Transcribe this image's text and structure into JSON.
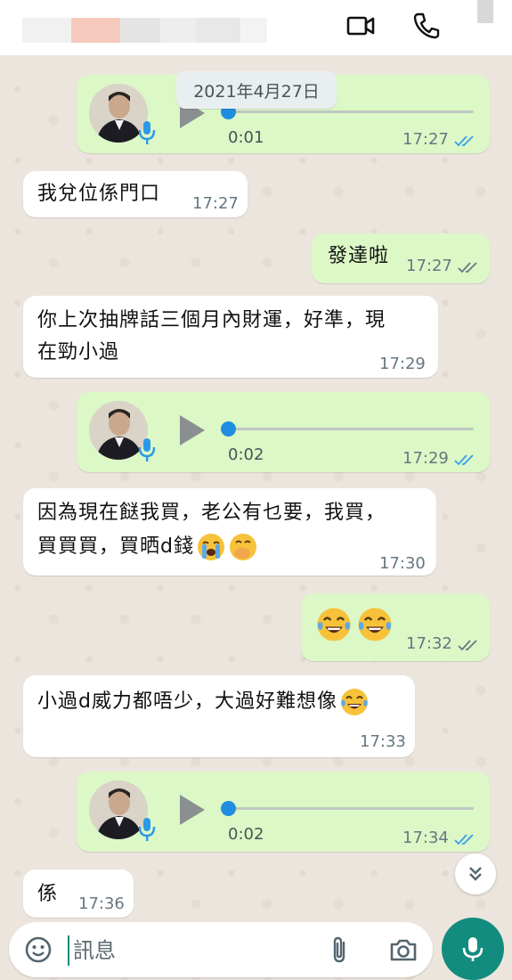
{
  "header": {
    "video_call_icon": "video-camera",
    "voice_call_icon": "phone",
    "blur_colors": [
      "#f1f1f1",
      "#f6c9bd",
      "#e4e4e4",
      "#eeeeee",
      "#e8e8e8",
      "#f3f3f3",
      "#dddddd"
    ]
  },
  "date_chip": "2021年4月27日",
  "messages": [
    {
      "type": "voice",
      "direction": "out",
      "duration": "0:01",
      "time": "17:27",
      "ticks": "read"
    },
    {
      "type": "text",
      "direction": "in",
      "lines": [
        "我兌位係門口"
      ],
      "time": "17:27"
    },
    {
      "type": "text",
      "direction": "out",
      "lines": [
        "發達啦"
      ],
      "time": "17:27",
      "ticks": "delivered"
    },
    {
      "type": "text",
      "direction": "in",
      "lines": [
        "你上次抽牌話三個月內財運，好準，現",
        "在勁小過"
      ],
      "time": "17:29"
    },
    {
      "type": "voice",
      "direction": "out",
      "duration": "0:02",
      "time": "17:29",
      "ticks": "read"
    },
    {
      "type": "text",
      "direction": "in",
      "lines": [
        "因為現在餸我買，老公有乜要，我買，",
        "買買買，買晒d錢"
      ],
      "emojis": [
        "loudly-crying-face",
        "face-with-hand-over-mouth"
      ],
      "time": "17:30"
    },
    {
      "type": "emoji",
      "direction": "out",
      "emojis": [
        "face-with-tears-of-joy",
        "face-with-tears-of-joy"
      ],
      "time": "17:32",
      "ticks": "delivered"
    },
    {
      "type": "text",
      "direction": "in",
      "lines": [
        "小過d威力都唔少，大過好難想像"
      ],
      "emojis": [
        "face-with-tears-of-joy"
      ],
      "time": "17:33"
    },
    {
      "type": "voice",
      "direction": "out",
      "duration": "0:02",
      "time": "17:34",
      "ticks": "read"
    },
    {
      "type": "text",
      "direction": "in",
      "lines": [
        "係"
      ],
      "time": "17:36"
    }
  ],
  "composer": {
    "placeholder": "訊息",
    "emoji_icon": "emoji-smiley",
    "attach_icon": "paperclip",
    "camera_icon": "camera",
    "send_icon": "microphone"
  },
  "colors": {
    "incoming_bubble": "#ffffff",
    "outgoing_bubble": "#dcf8c6",
    "read_ticks": "#34a0e8",
    "delivered_ticks": "#667781",
    "accent": "#128c7e"
  }
}
